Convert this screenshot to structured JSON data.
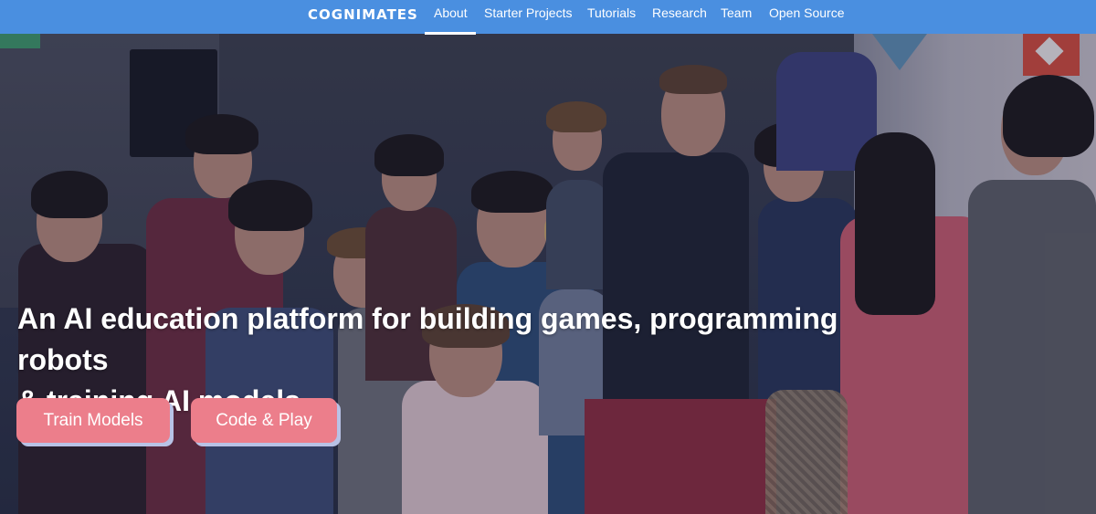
{
  "nav": {
    "brand": "COGNIMATES",
    "links": [
      "About",
      "Starter Projects",
      "Tutorials",
      "Research",
      "Team",
      "Open Source"
    ],
    "active": "About"
  },
  "hero": {
    "headline_line1": "An AI education platform for building games, programming robots",
    "headline_line2": "& training AI models",
    "buttons": [
      "Train Models",
      "Code & Play"
    ]
  },
  "colors": {
    "nav_bg": "#4a8fe0",
    "button_bg": "#ec7e8b",
    "button_shadow": "#b8c2e6",
    "text": "#ffffff"
  }
}
